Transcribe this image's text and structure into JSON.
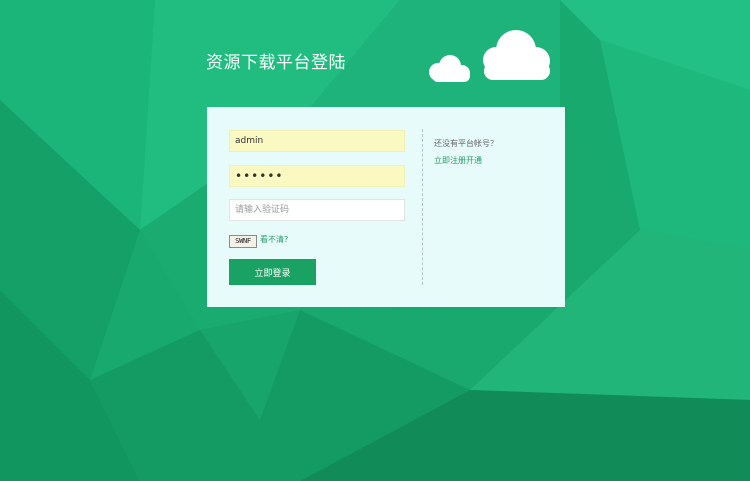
{
  "page": {
    "title": "资源下载平台登陆"
  },
  "login": {
    "username_value": "admin",
    "password_value": "••••••",
    "captcha_placeholder": "请输入验证码",
    "captcha_code": "SWNF",
    "refresh_label": "看不清?",
    "login_button": "立即登录"
  },
  "signup": {
    "prompt": "还没有平台帐号？",
    "link_label": "立即注册开通"
  },
  "icons": {
    "clouds": "cloud-icon"
  },
  "colors": {
    "background": "#17a96d",
    "panel": "#e8fbfb",
    "button": "#1aa264",
    "link": "#2a9b67",
    "autofill": "#faf9c2"
  }
}
